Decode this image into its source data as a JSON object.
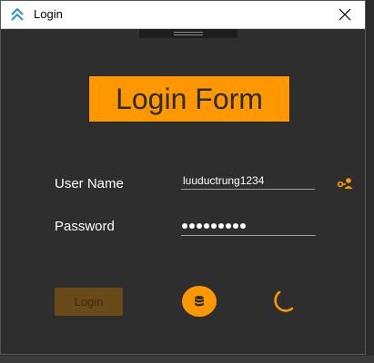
{
  "window": {
    "title": "Login"
  },
  "header": {
    "title": "Login Form"
  },
  "form": {
    "username_label": "User Name",
    "username_value": "luuductrung1234",
    "password_label": "Password",
    "password_masked_length": 9
  },
  "actions": {
    "login_label": "Login"
  },
  "icons": {
    "app": "chevrons-up-icon",
    "close": "close-icon",
    "user_add": "account-key-icon",
    "database": "database-icon",
    "spinner": "loading-spinner-icon"
  },
  "colors": {
    "accent": "#ff9800",
    "background": "#2e2e2e",
    "login_disabled": "#6b4a1a",
    "app_icon": "#2a8fd8"
  }
}
